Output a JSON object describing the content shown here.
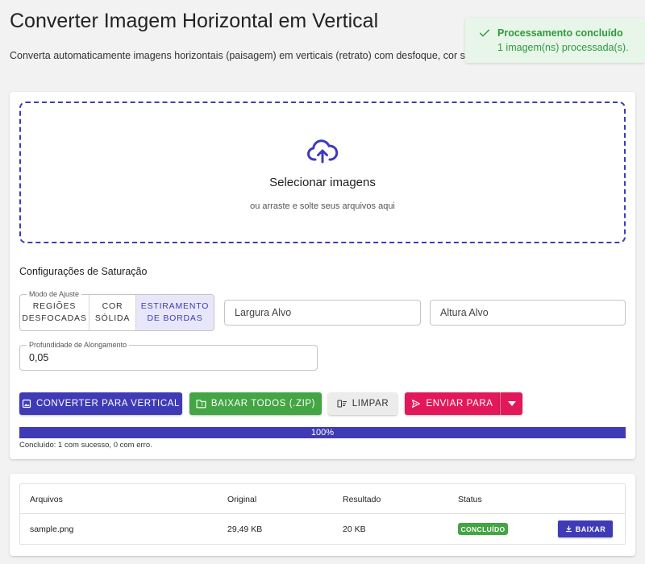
{
  "header": {
    "title": "Converter Imagem Horizontal em Vertical",
    "description": "Converta automaticamente imagens horizontais (paisagem) em verticais (retrato) com desfoque, cor sólida ou estiramento de bordas."
  },
  "toast": {
    "title": "Processamento concluído",
    "message": "1 imagem(ns) processada(s)."
  },
  "dropzone": {
    "title": "Selecionar imagens",
    "subtitle": "ou arraste e solte seus arquivos aqui"
  },
  "settings": {
    "section_title": "Configurações de Saturação",
    "mode_legend": "Modo de Ajuste",
    "modes": [
      "REGIÕES\nDESFOCADAS",
      "COR\nSÓLIDA",
      "ESTIRAMENTO\nDE BORDAS"
    ],
    "active_mode": 2,
    "width_placeholder": "Largura Alvo",
    "height_placeholder": "Altura Alvo",
    "depth_legend": "Profundidade de Alongamento",
    "depth_value": "0,05"
  },
  "actions": {
    "convert": "CONVERTER PARA VERTICAL",
    "download_zip": "BAIXAR TODOS (.ZIP)",
    "clear": "LIMPAR",
    "send_to": "ENVIAR PARA"
  },
  "progress": {
    "percent": 100,
    "label": "100%",
    "status": "Concluído: 1 com sucesso, 0 com erro."
  },
  "table": {
    "headers": [
      "Arquivos",
      "Original",
      "Resultado",
      "Status"
    ],
    "rows": [
      {
        "file": "sample.png",
        "original": "29,49 KB",
        "result": "20 KB",
        "status": "CONCLUÍDO",
        "action": "BAIXAR"
      }
    ]
  },
  "colors": {
    "primary": "#3f3bb6",
    "success": "#43a543",
    "accent": "#e2185b",
    "toast_bg": "#e8f5e9"
  }
}
